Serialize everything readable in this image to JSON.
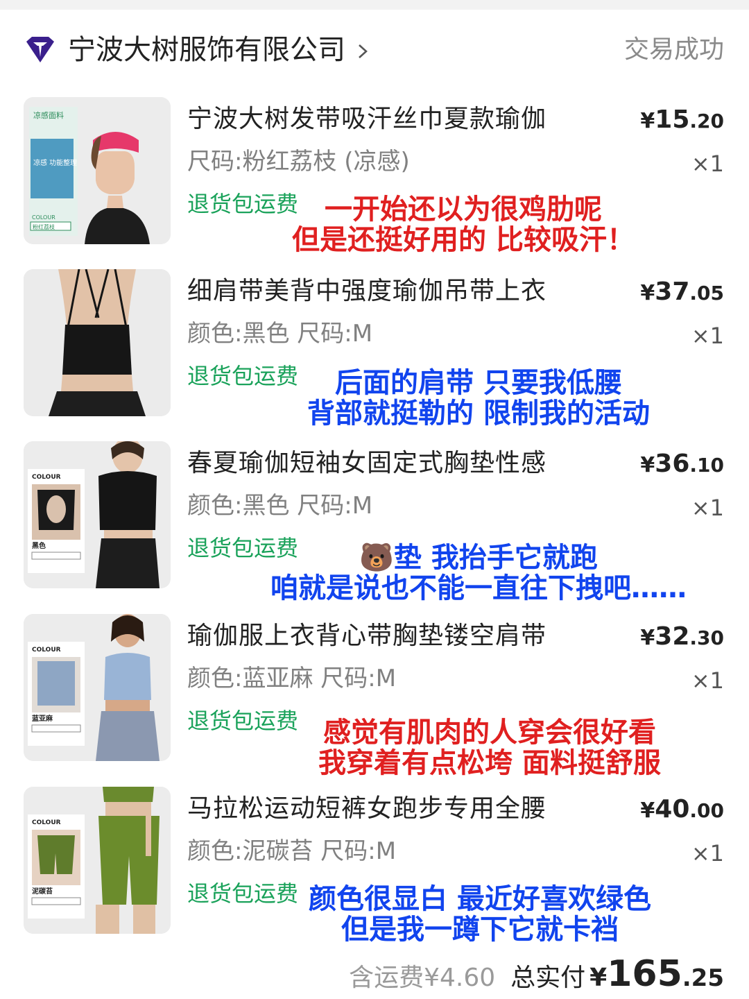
{
  "header": {
    "shop_name": "宁波大树服饰有限公司",
    "status": "交易成功"
  },
  "items": [
    {
      "title": "宁波大树发带吸汗丝巾夏款瑜伽",
      "spec": "尺码:粉红荔枝 (凉感)",
      "tag": "退货包运费",
      "price_symbol": "¥",
      "price_int": "15",
      "price_dec": ".20",
      "qty": "×1",
      "thumb_text": [
        "凉感面料",
        "凉感 功能整理",
        "COLOUR",
        "粉红荔枝"
      ],
      "note_line1": "一开始还以为很鸡肋呢",
      "note_line2": "但是还挺好用的 比较吸汗！",
      "note_color": "#e02020"
    },
    {
      "title": "细肩带美背中强度瑜伽吊带上衣",
      "spec": "颜色:黑色 尺码:M",
      "tag": "退货包运费",
      "price_symbol": "¥",
      "price_int": "37",
      "price_dec": ".05",
      "qty": "×1",
      "note_line1": "后面的肩带 只要我低腰",
      "note_line2": "背部就挺勒的 限制我的活动",
      "note_color": "#1144ee"
    },
    {
      "title": "春夏瑜伽短袖女固定式胸垫性感",
      "spec": "颜色:黑色 尺码:M",
      "tag": "退货包运费",
      "price_symbol": "¥",
      "price_int": "36",
      "price_dec": ".10",
      "qty": "×1",
      "thumb_text": [
        "COLOUR",
        "黑色"
      ],
      "note_line1": "🐻垫 我抬手它就跑",
      "note_line2": "咱就是说也不能一直往下拽吧……",
      "note_color": "#1144ee"
    },
    {
      "title": "瑜伽服上衣背心带胸垫镂空肩带",
      "spec": "颜色:蓝亚麻 尺码:M",
      "tag": "退货包运费",
      "price_symbol": "¥",
      "price_int": "32",
      "price_dec": ".30",
      "qty": "×1",
      "thumb_text": [
        "COLOUR",
        "蓝亚麻"
      ],
      "note_line1": "感觉有肌肉的人穿会很好看",
      "note_line2": "我穿着有点松垮 面料挺舒服",
      "note_color": "#e02020"
    },
    {
      "title": "马拉松运动短裤女跑步专用全腰",
      "spec": "颜色:泥碳苔 尺码:M",
      "tag": "退货包运费",
      "price_symbol": "¥",
      "price_int": "40",
      "price_dec": ".00",
      "qty": "×1",
      "thumb_text": [
        "COLOUR",
        "泥碳苔"
      ],
      "note_line1": "颜色很显白 最近好喜欢绿色",
      "note_line2": "但是我一蹲下它就卡裆",
      "note_color": "#1144ee"
    }
  ],
  "footer": {
    "shipping": "含运费¥4.60",
    "total_label": "总实付",
    "total_symbol": "¥",
    "total_int": "165",
    "total_dec": ".25"
  },
  "colors": {
    "tag_green": "#1aa25a",
    "note_red": "#e02020",
    "note_blue": "#1144ee",
    "muted_gray": "#808080"
  },
  "icons": [
    "shop-logo-icon",
    "chevron-right-icon"
  ]
}
